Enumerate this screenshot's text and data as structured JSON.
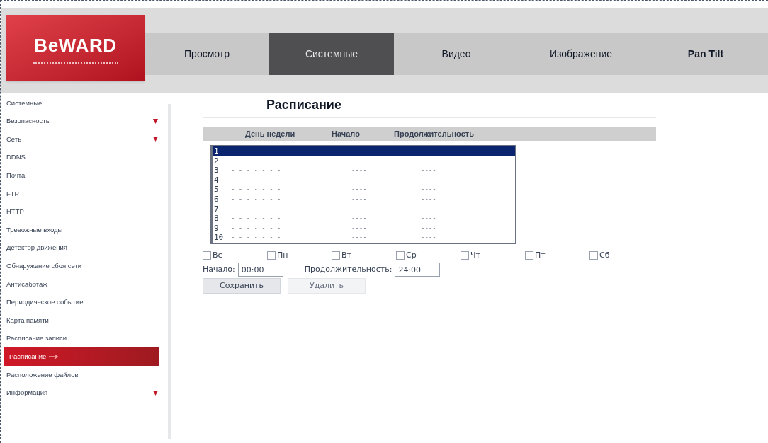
{
  "logo": {
    "text": "BeWARD"
  },
  "tabs": [
    {
      "label": "Просмотр",
      "selected": false
    },
    {
      "label": "Системные",
      "selected": true
    },
    {
      "label": "Видео",
      "selected": false
    },
    {
      "label": "Изображение",
      "selected": false
    },
    {
      "label": "Pan Tilt",
      "selected": false
    }
  ],
  "sidebar": {
    "items": [
      {
        "label": "Системные",
        "submenu": false,
        "selected": false
      },
      {
        "label": "Безопасность",
        "submenu": true,
        "selected": false
      },
      {
        "label": "Сеть",
        "submenu": true,
        "selected": false
      },
      {
        "label": "DDNS",
        "submenu": false,
        "selected": false
      },
      {
        "label": "Почта",
        "submenu": false,
        "selected": false
      },
      {
        "label": "FTP",
        "submenu": false,
        "selected": false
      },
      {
        "label": "HTTP",
        "submenu": false,
        "selected": false
      },
      {
        "label": "Тревожные входы",
        "submenu": false,
        "selected": false
      },
      {
        "label": "Детектор движения",
        "submenu": false,
        "selected": false
      },
      {
        "label": "Обнаружение сбоя сети",
        "submenu": false,
        "selected": false
      },
      {
        "label": "Антисаботаж",
        "submenu": false,
        "selected": false
      },
      {
        "label": "Периодическое событие",
        "submenu": false,
        "selected": false
      },
      {
        "label": "Карта памяти",
        "submenu": false,
        "selected": false
      },
      {
        "label": "Расписание записи",
        "submenu": false,
        "selected": false
      },
      {
        "label": "Расписание",
        "submenu": false,
        "selected": true
      },
      {
        "label": "Расположение файлов",
        "submenu": false,
        "selected": false
      },
      {
        "label": "Информация",
        "submenu": true,
        "selected": false
      }
    ]
  },
  "page_title": "Расписание",
  "table": {
    "columns": [
      "День недели",
      "Начало",
      "Продолжительность"
    ],
    "rows": [
      {
        "index": "1",
        "days": "- - - - - - -",
        "start": "----",
        "duration": "----",
        "selected": true
      },
      {
        "index": "2",
        "days": "- - - - - - -",
        "start": "----",
        "duration": "----",
        "selected": false
      },
      {
        "index": "3",
        "days": "- - - - - - -",
        "start": "----",
        "duration": "----",
        "selected": false
      },
      {
        "index": "4",
        "days": "- - - - - - -",
        "start": "----",
        "duration": "----",
        "selected": false
      },
      {
        "index": "5",
        "days": "- - - - - - -",
        "start": "----",
        "duration": "----",
        "selected": false
      },
      {
        "index": "6",
        "days": "- - - - - - -",
        "start": "----",
        "duration": "----",
        "selected": false
      },
      {
        "index": "7",
        "days": "- - - - - - -",
        "start": "----",
        "duration": "----",
        "selected": false
      },
      {
        "index": "8",
        "days": "- - - - - - -",
        "start": "----",
        "duration": "----",
        "selected": false
      },
      {
        "index": "9",
        "days": "- - - - - - -",
        "start": "----",
        "duration": "----",
        "selected": false
      },
      {
        "index": "10",
        "days": "- - - - - - -",
        "start": "----",
        "duration": "----",
        "selected": false
      }
    ]
  },
  "days": [
    {
      "label": "Вс",
      "checked": false
    },
    {
      "label": "Пн",
      "checked": false
    },
    {
      "label": "Вт",
      "checked": false
    },
    {
      "label": "Ср",
      "checked": false
    },
    {
      "label": "Чт",
      "checked": false
    },
    {
      "label": "Пт",
      "checked": false
    },
    {
      "label": "Сб",
      "checked": false
    }
  ],
  "start": {
    "label": "Начало:",
    "value": "00:00"
  },
  "duration": {
    "label": "Продолжительность:",
    "value": "24:00"
  },
  "buttons": [
    {
      "label": "Сохранить",
      "disabled": false
    },
    {
      "label": "Удалить",
      "disabled": true
    }
  ]
}
